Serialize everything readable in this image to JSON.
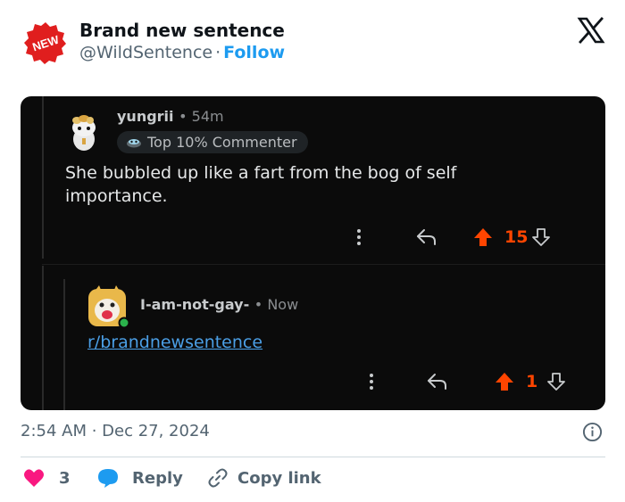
{
  "author": {
    "name": "Brand new sentence",
    "handle": "@WildSentence",
    "separator": "·",
    "follow_label": "Follow",
    "avatar_label": "NEW"
  },
  "screenshot": {
    "comment1": {
      "username": "yungrii",
      "time": "54m",
      "badge": "Top 10% Commenter",
      "body": "She bubbled up like a fart from the bog of self importance.",
      "votes": "15"
    },
    "comment2": {
      "username": "I-am-not-gay-",
      "time": "Now",
      "link": "r/brandnewsentence",
      "votes": "1"
    }
  },
  "post": {
    "timestamp": "2:54 AM · Dec 27, 2024"
  },
  "footer": {
    "like_count": "3",
    "reply_label": "Reply",
    "copy_label": "Copy link"
  },
  "colors": {
    "accent": "#1d9bf0",
    "upvote": "#ff4500",
    "like": "#f91880",
    "screenshot_bg": "#0b0b0b"
  }
}
